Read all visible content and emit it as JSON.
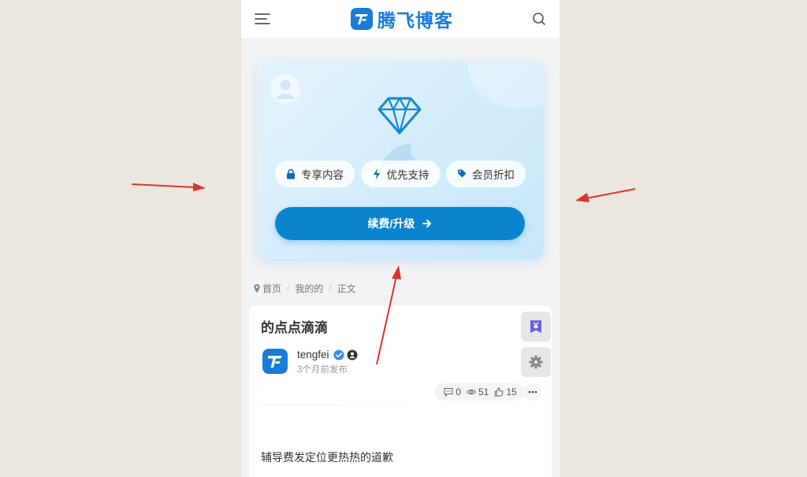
{
  "header": {
    "logo_text": "腾飞博客",
    "menu_icon": "menu-icon",
    "search_icon": "search-icon"
  },
  "vip_card": {
    "perks": [
      {
        "icon": "lock-icon",
        "label": "专享内容"
      },
      {
        "icon": "bolt-icon",
        "label": "优先支持"
      },
      {
        "icon": "tag-icon",
        "label": "会员折扣"
      }
    ],
    "renew_label": "续费/升级",
    "accent": "#0b84d0"
  },
  "breadcrumb": [
    "首页",
    "我的的",
    "正文"
  ],
  "article": {
    "title": "的点点滴滴",
    "author": "tengfei",
    "time": "3个月前发布",
    "stats": {
      "comments": "0",
      "views": "51",
      "likes": "15"
    },
    "body": "辅导费发定位更热热的道歉"
  }
}
